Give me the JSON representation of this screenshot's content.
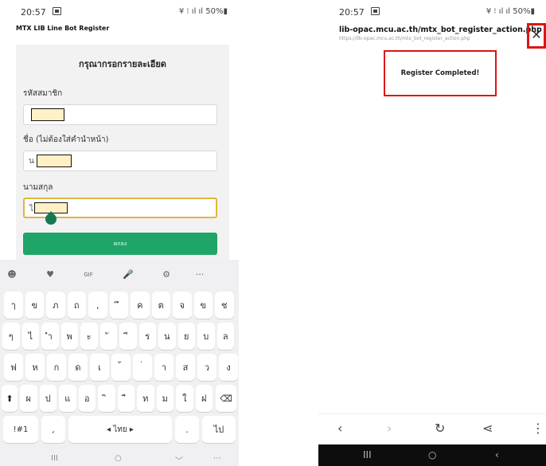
{
  "left": {
    "status": {
      "time": "20:57",
      "right": "¥ ⁝ ıl ıl 50%▮"
    },
    "app_title": "MTX LIB Line Bot Register",
    "form": {
      "title": "กรุณากรอกรายละเอียด",
      "member_id_label": "รหัสสมาชิก",
      "name_label": "ชื่อ (ไม่ต้องใส่คำนำหน้า)",
      "name_prefix": "น",
      "surname_label": "นามสกุล",
      "surname_prefix": "ไ",
      "submit_label": "ตกลง"
    },
    "keyboard": {
      "toolbar": [
        "☻",
        "♥",
        "GIF",
        "🎤",
        "⚙",
        "···"
      ],
      "row1": [
        "ๅ",
        "ข",
        "ภ",
        "ถ",
        ",",
        "ึ",
        "ค",
        "ต",
        "จ",
        "ข",
        "ช"
      ],
      "row2": [
        "ๆ",
        "ไ",
        "ำ",
        "พ",
        "ะ",
        "ั",
        "ี",
        "ร",
        "น",
        "ย",
        "บ",
        "ล"
      ],
      "row3": [
        "ฟ",
        "ห",
        "ก",
        "ด",
        "เ",
        "้",
        "่",
        "า",
        "ส",
        "ว",
        "ง"
      ],
      "row4": [
        "ผ",
        "ป",
        "แ",
        "อ",
        "ิ",
        "ื",
        "ท",
        "ม",
        "ใ",
        "ฝ"
      ],
      "shift": "⬆",
      "backspace": "⌫",
      "symbols": "!#1",
      "comma": ",",
      "space": "◂ ไทย ▸",
      "period": ".",
      "enter": "ไป",
      "nav": [
        "III",
        "○",
        "﹀",
        "⋯"
      ]
    }
  },
  "right": {
    "status": {
      "time": "20:57",
      "right": "¥ ⁝ ıl ıl 50%▮"
    },
    "url_main": "lib-opac.mcu.ac.th/mtx_bot_register_action.php",
    "url_sub": "https://lib-opac.mcu.ac.th/mtx_bot_register_action.php",
    "close": "✕",
    "message": "Register Completed!",
    "browser_bar": [
      "‹",
      "›",
      "↻",
      "⋖",
      "⋮"
    ],
    "nav": [
      "III",
      "○",
      "‹"
    ]
  }
}
